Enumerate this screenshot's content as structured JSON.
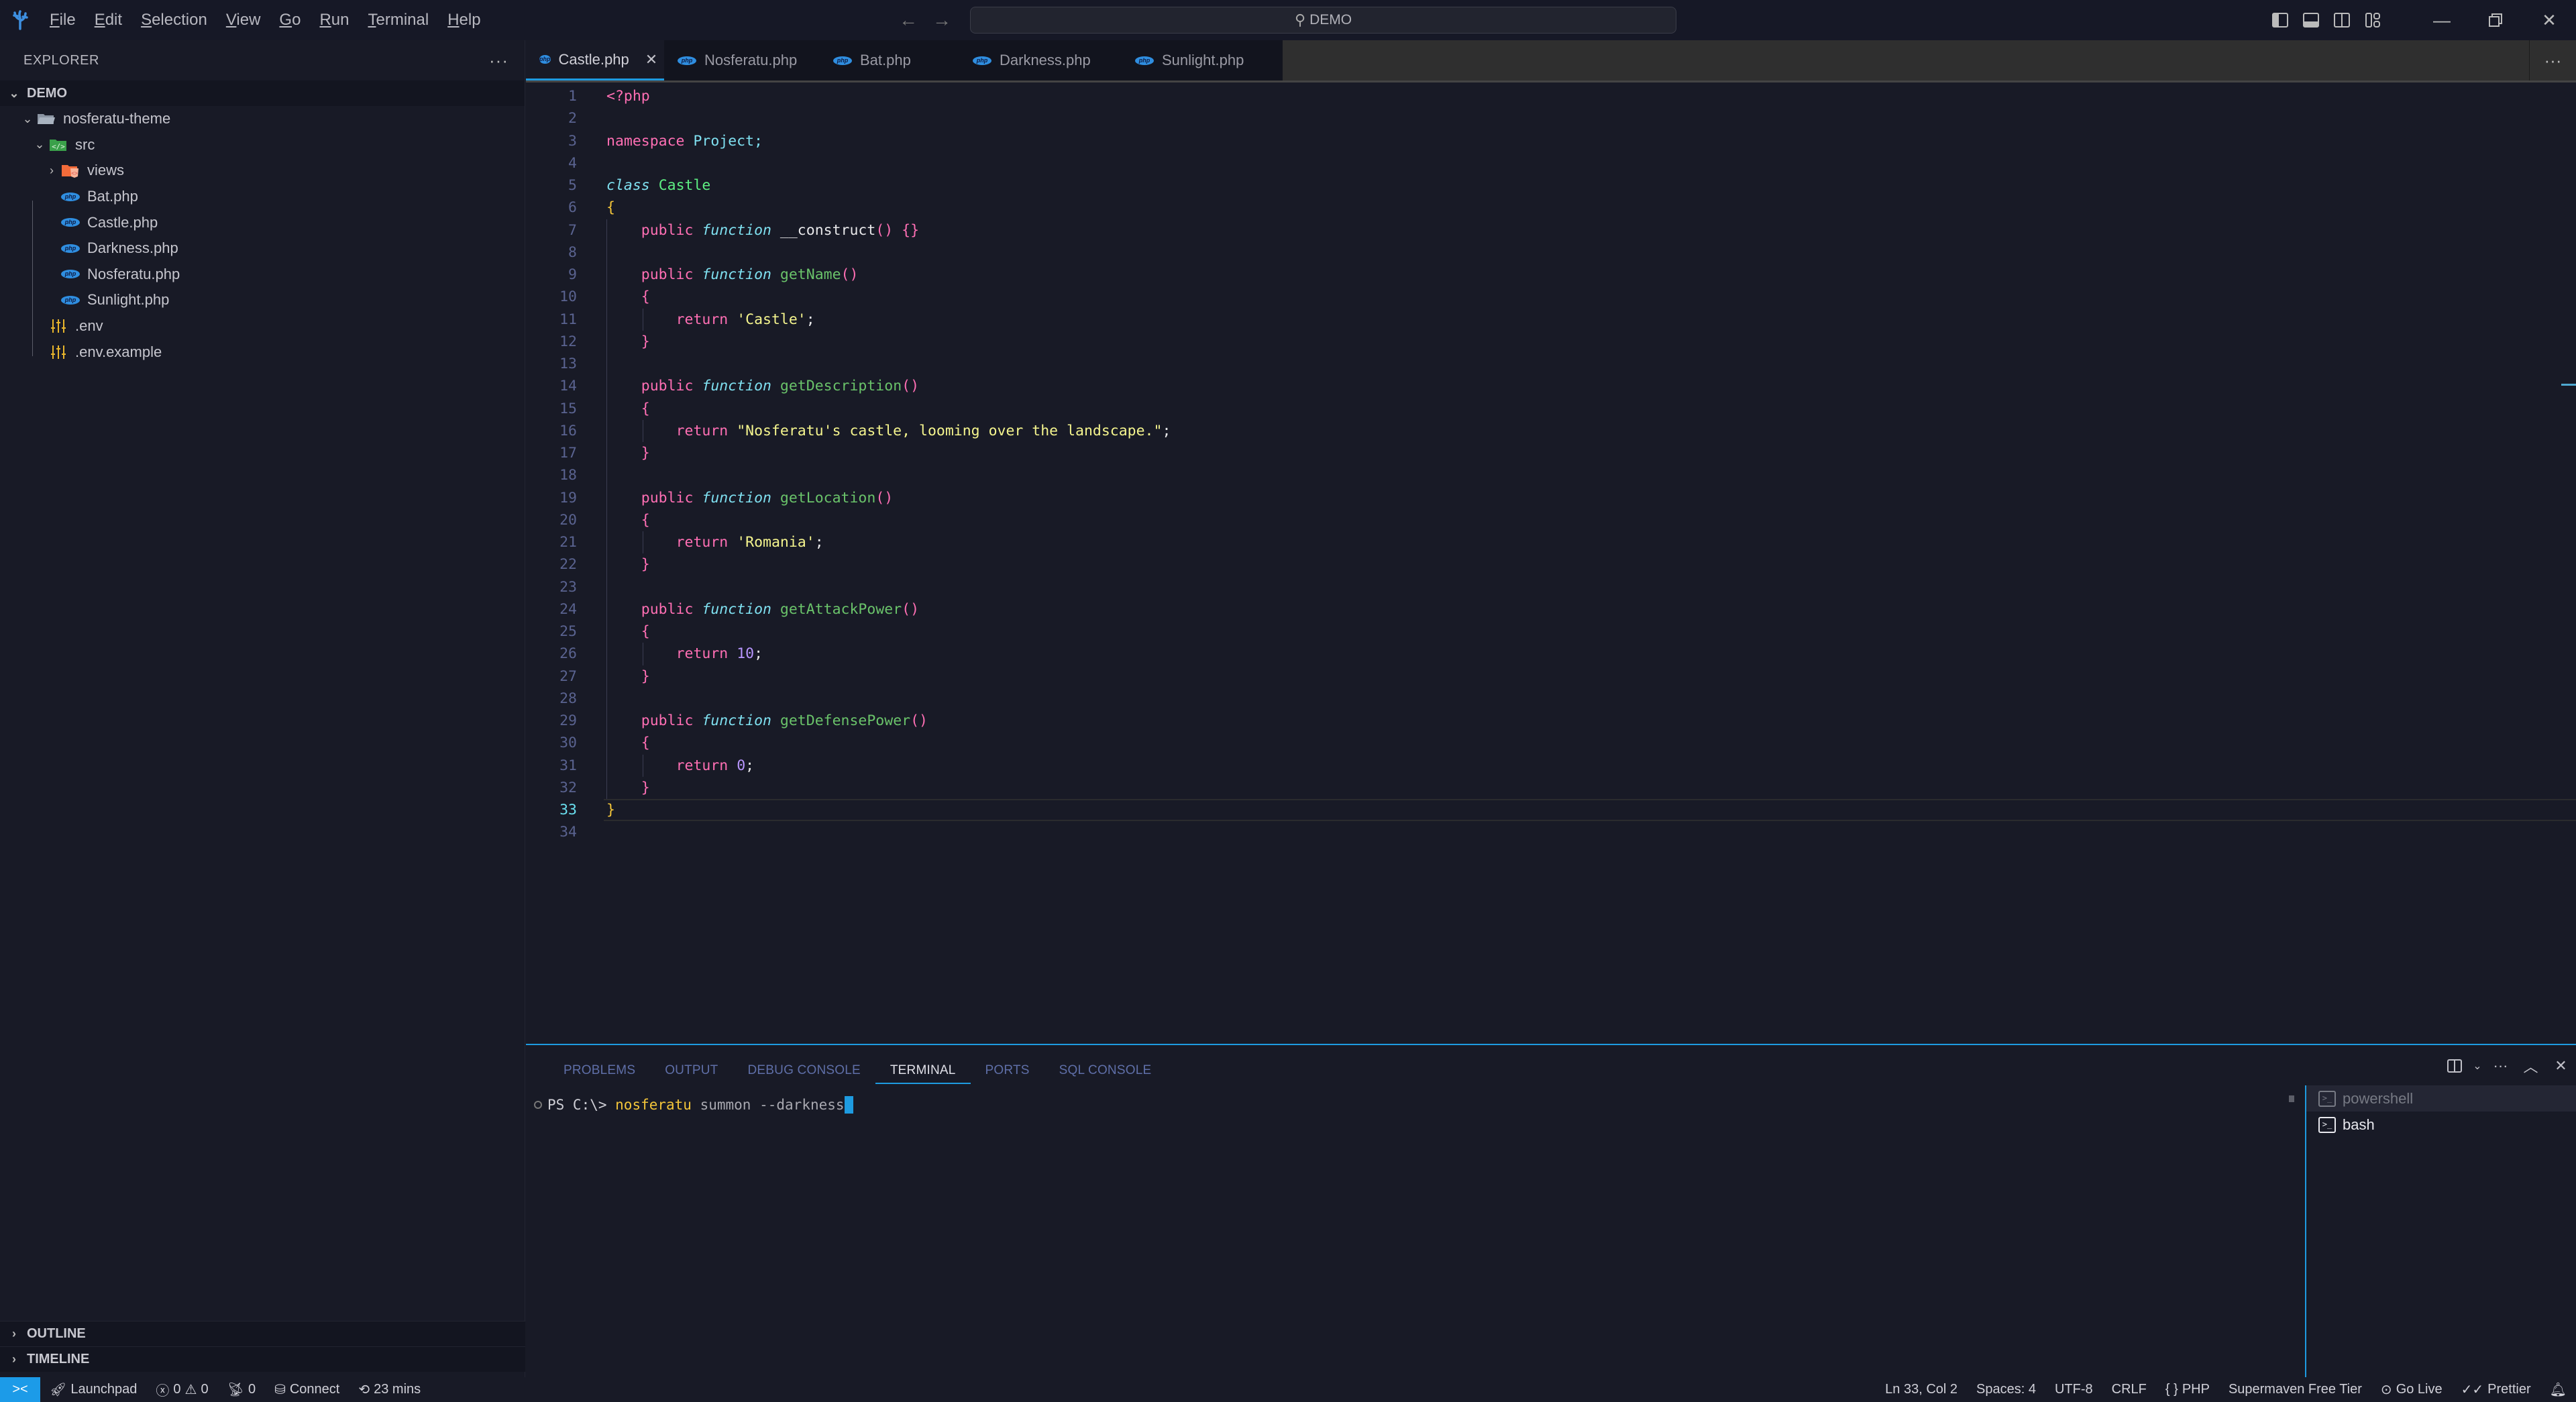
{
  "titlebar": {
    "menu": [
      "File",
      "Edit",
      "Selection",
      "View",
      "Go",
      "Run",
      "Terminal",
      "Help"
    ],
    "menu_mnemonics": [
      "F",
      "E",
      "S",
      "V",
      "G",
      "R",
      "T",
      "H"
    ],
    "command_center": "DEMO",
    "back_icon": "←",
    "forward_icon": "→"
  },
  "sidebar": {
    "title": "EXPLORER",
    "more": "···",
    "section": "DEMO",
    "tree": [
      {
        "label": "nosferatu-theme",
        "type": "folder-open",
        "depth": 1
      },
      {
        "label": "src",
        "type": "folder-src",
        "depth": 2
      },
      {
        "label": "views",
        "type": "folder-views",
        "depth": 3
      },
      {
        "label": "Bat.php",
        "type": "php",
        "depth": 3
      },
      {
        "label": "Castle.php",
        "type": "php",
        "depth": 3
      },
      {
        "label": "Darkness.php",
        "type": "php",
        "depth": 3
      },
      {
        "label": "Nosferatu.php",
        "type": "php",
        "depth": 3
      },
      {
        "label": "Sunlight.php",
        "type": "php",
        "depth": 3
      },
      {
        "label": ".env",
        "type": "env",
        "depth": 2
      },
      {
        "label": ".env.example",
        "type": "env",
        "depth": 2
      }
    ],
    "outline": "OUTLINE",
    "timeline": "TIMELINE"
  },
  "tabs": [
    {
      "label": "Castle.php",
      "active": true
    },
    {
      "label": "Nosferatu.php",
      "active": false
    },
    {
      "label": "Bat.php",
      "active": false
    },
    {
      "label": "Darkness.php",
      "active": false
    },
    {
      "label": "Sunlight.php",
      "active": false
    }
  ],
  "editor": {
    "current_line": 33,
    "lines": [
      [
        [
          "kw",
          "<?php"
        ]
      ],
      [],
      [
        [
          "kw",
          "namespace"
        ],
        [
          "plain",
          " "
        ],
        [
          "ns",
          "Project;"
        ]
      ],
      [],
      [
        [
          "type",
          "class"
        ],
        [
          "plain",
          " "
        ],
        [
          "cls",
          "Castle"
        ]
      ],
      [
        [
          "br-y",
          "{"
        ]
      ],
      [
        [
          "plain",
          "    "
        ],
        [
          "kw",
          "public"
        ],
        [
          "plain",
          " "
        ],
        [
          "type",
          "function"
        ],
        [
          "plain",
          " __construct"
        ],
        [
          "br-p",
          "()"
        ],
        [
          "plain",
          " "
        ],
        [
          "br-p",
          "{}"
        ]
      ],
      [],
      [
        [
          "plain",
          "    "
        ],
        [
          "kw",
          "public"
        ],
        [
          "plain",
          " "
        ],
        [
          "type",
          "function"
        ],
        [
          "plain",
          " "
        ],
        [
          "fn",
          "getName"
        ],
        [
          "br-p",
          "()"
        ]
      ],
      [
        [
          "plain",
          "    "
        ],
        [
          "br-p",
          "{"
        ]
      ],
      [
        [
          "plain",
          "        "
        ],
        [
          "kw",
          "return"
        ],
        [
          "plain",
          " "
        ],
        [
          "str",
          "'Castle'"
        ],
        [
          "plain",
          ";"
        ]
      ],
      [
        [
          "plain",
          "    "
        ],
        [
          "br-p",
          "}"
        ]
      ],
      [],
      [
        [
          "plain",
          "    "
        ],
        [
          "kw",
          "public"
        ],
        [
          "plain",
          " "
        ],
        [
          "type",
          "function"
        ],
        [
          "plain",
          " "
        ],
        [
          "fn",
          "getDescription"
        ],
        [
          "br-p",
          "()"
        ]
      ],
      [
        [
          "plain",
          "    "
        ],
        [
          "br-p",
          "{"
        ]
      ],
      [
        [
          "plain",
          "        "
        ],
        [
          "kw",
          "return"
        ],
        [
          "plain",
          " "
        ],
        [
          "str",
          "\"Nosferatu's castle, looming over the landscape.\""
        ],
        [
          "plain",
          ";"
        ]
      ],
      [
        [
          "plain",
          "    "
        ],
        [
          "br-p",
          "}"
        ]
      ],
      [],
      [
        [
          "plain",
          "    "
        ],
        [
          "kw",
          "public"
        ],
        [
          "plain",
          " "
        ],
        [
          "type",
          "function"
        ],
        [
          "plain",
          " "
        ],
        [
          "fn",
          "getLocation"
        ],
        [
          "br-p",
          "()"
        ]
      ],
      [
        [
          "plain",
          "    "
        ],
        [
          "br-p",
          "{"
        ]
      ],
      [
        [
          "plain",
          "        "
        ],
        [
          "kw",
          "return"
        ],
        [
          "plain",
          " "
        ],
        [
          "str",
          "'Romania'"
        ],
        [
          "plain",
          ";"
        ]
      ],
      [
        [
          "plain",
          "    "
        ],
        [
          "br-p",
          "}"
        ]
      ],
      [],
      [
        [
          "plain",
          "    "
        ],
        [
          "kw",
          "public"
        ],
        [
          "plain",
          " "
        ],
        [
          "type",
          "function"
        ],
        [
          "plain",
          " "
        ],
        [
          "fn",
          "getAttackPower"
        ],
        [
          "br-p",
          "()"
        ]
      ],
      [
        [
          "plain",
          "    "
        ],
        [
          "br-p",
          "{"
        ]
      ],
      [
        [
          "plain",
          "        "
        ],
        [
          "kw",
          "return"
        ],
        [
          "plain",
          " "
        ],
        [
          "num",
          "10"
        ],
        [
          "plain",
          ";"
        ]
      ],
      [
        [
          "plain",
          "    "
        ],
        [
          "br-p",
          "}"
        ]
      ],
      [],
      [
        [
          "plain",
          "    "
        ],
        [
          "kw",
          "public"
        ],
        [
          "plain",
          " "
        ],
        [
          "type",
          "function"
        ],
        [
          "plain",
          " "
        ],
        [
          "fn",
          "getDefensePower"
        ],
        [
          "br-p",
          "()"
        ]
      ],
      [
        [
          "plain",
          "    "
        ],
        [
          "br-p",
          "{"
        ]
      ],
      [
        [
          "plain",
          "        "
        ],
        [
          "kw",
          "return"
        ],
        [
          "plain",
          " "
        ],
        [
          "num",
          "0"
        ],
        [
          "plain",
          ";"
        ]
      ],
      [
        [
          "plain",
          "    "
        ],
        [
          "br-p",
          "}"
        ]
      ],
      [
        [
          "br-y",
          "}"
        ]
      ],
      []
    ]
  },
  "panel": {
    "tabs": [
      "PROBLEMS",
      "OUTPUT",
      "DEBUG CONSOLE",
      "TERMINAL",
      "PORTS",
      "SQL CONSOLE"
    ],
    "active_tab": "TERMINAL",
    "terminal": {
      "prompt": "PS C:\\> ",
      "command": "nosferatu",
      "args": " summon --darkness"
    },
    "terminals": [
      {
        "label": "powershell",
        "active": true
      },
      {
        "label": "bash",
        "active": false
      }
    ]
  },
  "statusbar": {
    "launchpad": "Launchpad",
    "errors": "0",
    "warnings": "0",
    "ports": "0",
    "connect": "Connect",
    "time": "23 mins",
    "position": "Ln 33, Col 2",
    "spaces": "Spaces: 4",
    "encoding": "UTF-8",
    "eol": "CRLF",
    "language": "PHP",
    "supermaven": "Supermaven Free Tier",
    "golive": "Go Live",
    "prettier": "Prettier"
  },
  "colors": {
    "accent": "#1e9be0",
    "background": "#181a26",
    "keyword": "#ff6fb4",
    "type": "#7fe0f0",
    "class": "#5ef083",
    "function": "#6ac36a",
    "string": "#f5f58e",
    "number": "#b896ff"
  }
}
